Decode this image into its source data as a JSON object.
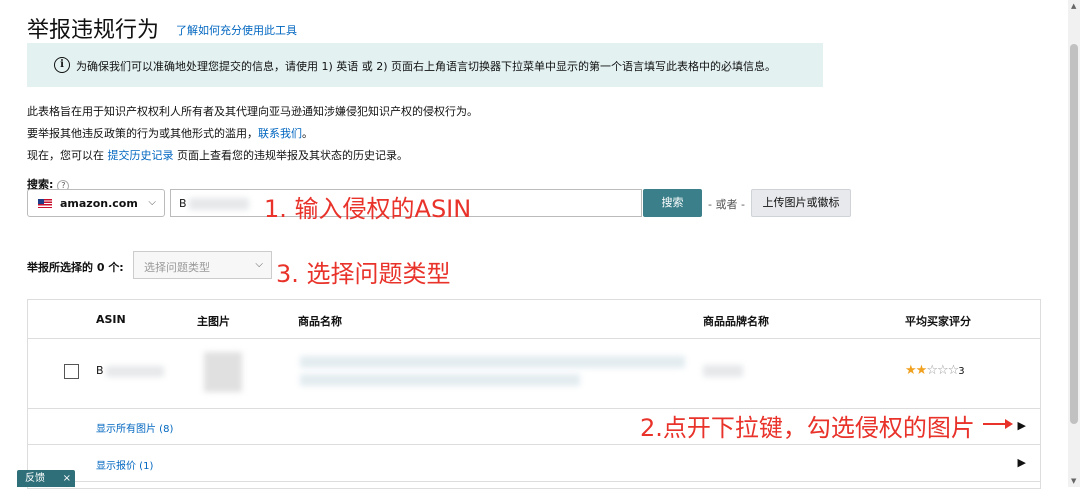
{
  "page": {
    "title": "举报违规行为",
    "help_link": "了解如何充分使用此工具"
  },
  "info_banner": {
    "icon": "info-icon",
    "text": "为确保我们可以准确地处理您提交的信息，请使用 1) 英语 或 2) 页面右上角语言切换器下拉菜单中显示的第一个语言填写此表格中的必填信息。"
  },
  "description": {
    "line1": "此表格旨在用于知识产权权利人所有者及其代理向亚马逊通知涉嫌侵犯知识产权的侵权行为。",
    "line2_prefix": "要举报其他违反政策的行为或其他形式的滥用，",
    "line2_link": "联系我们",
    "line2_suffix": "。",
    "line3_prefix": "现在，您可以在 ",
    "line3_link": "提交历史记录",
    "line3_suffix": " 页面上查看您的违规举报及其状态的历史记录。"
  },
  "search": {
    "label": "搜索:",
    "help": "?",
    "marketplace": "amazon.com",
    "asin_value": "B",
    "button": "搜索",
    "or_text": "- 或者 -",
    "upload_button": "上传图片或徽标"
  },
  "report": {
    "label": "举报所选择的 0 个:",
    "issue_placeholder": "选择问题类型"
  },
  "table": {
    "headers": [
      "ASIN",
      "主图片",
      "商品名称",
      "商品品牌名称",
      "平均买家评分"
    ],
    "row": {
      "asin": "B",
      "rating_stars": "★★",
      "rating_empty": "☆☆☆",
      "rating_count": "3"
    },
    "show_all_images": "显示所有图片 (8)",
    "show_offers": "显示报价 (1)"
  },
  "annotations": {
    "step1": "1. 输入侵权的ASIN",
    "step2": "2.点开下拉键，勾选侵权的图片",
    "step3": "3. 选择问题类型",
    "color": "#e8322a"
  },
  "feedback": {
    "label": "反馈",
    "close": "×"
  }
}
